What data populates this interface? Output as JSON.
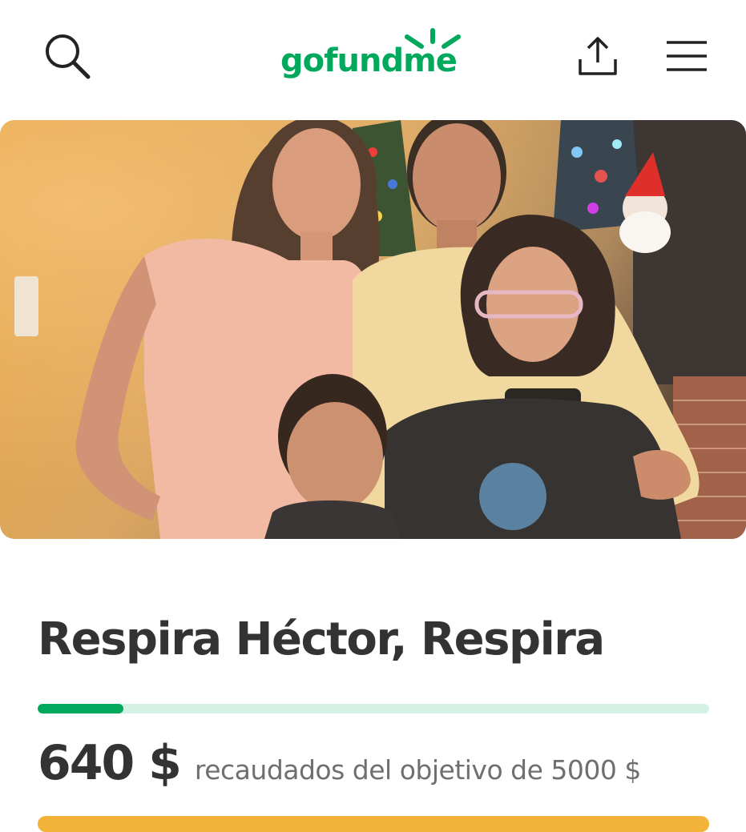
{
  "header": {
    "logo_text": "gofundme",
    "icons": {
      "search": "search-icon",
      "share": "share-icon",
      "menu": "menu-icon"
    }
  },
  "hero": {
    "image": "family-photo"
  },
  "campaign": {
    "title": "Respira Héctor, Respira",
    "raised_amount": "640 $",
    "raised_label": "recaudados del objetivo de 5000 $",
    "progress_fraction": 0.128
  },
  "colors": {
    "brand_green": "#02a95c",
    "progress_track": "#d4f2e3",
    "text_dark": "#333333",
    "text_muted": "#6f6f6f",
    "cta_orange": "#f3b23a"
  }
}
